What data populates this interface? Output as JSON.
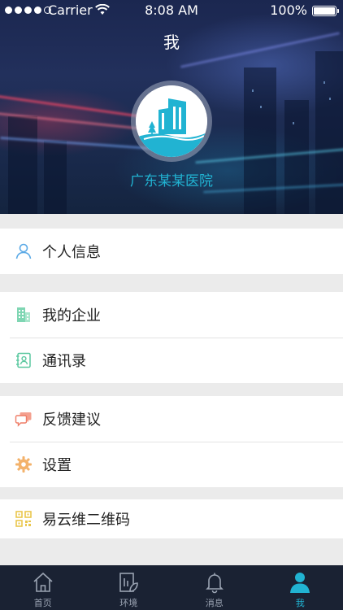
{
  "status_bar": {
    "carrier": "Carrier",
    "time": "8:08 AM",
    "battery": "100%"
  },
  "header": {
    "title": "我",
    "org_name": "广东某某医院",
    "accent_color": "#21b3d2"
  },
  "menu": {
    "groups": [
      {
        "items": [
          {
            "label": "个人信息",
            "icon": "user-icon"
          }
        ]
      },
      {
        "items": [
          {
            "label": "我的企业",
            "icon": "building-icon"
          },
          {
            "label": "通讯录",
            "icon": "contacts-icon"
          }
        ]
      },
      {
        "items": [
          {
            "label": "反馈建议",
            "icon": "feedback-icon"
          },
          {
            "label": "设置",
            "icon": "gear-icon"
          }
        ]
      },
      {
        "items": [
          {
            "label": "易云维二维码",
            "icon": "qr-code-icon"
          }
        ]
      }
    ]
  },
  "tabbar": {
    "tabs": [
      {
        "label": "首页",
        "icon": "home-icon",
        "active": false
      },
      {
        "label": "环境",
        "icon": "environment-icon",
        "active": false
      },
      {
        "label": "消息",
        "icon": "bell-icon",
        "active": false
      },
      {
        "label": "我",
        "icon": "profile-icon",
        "active": true
      }
    ],
    "active_color": "#21b3d2",
    "inactive_color": "#9aa3b2"
  }
}
